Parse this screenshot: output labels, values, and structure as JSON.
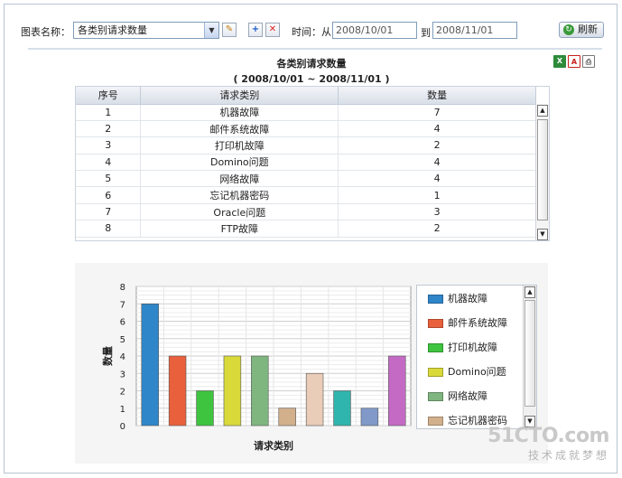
{
  "toolbar": {
    "chart_name_label": "图表名称：",
    "selected_chart": "各类别请求数量",
    "time_label": "时间：从",
    "from_date": "2008/10/01",
    "to_label": "到",
    "to_date": "2008/11/01",
    "refresh_label": "刷新"
  },
  "report": {
    "title": "各类别请求数量",
    "range": "( 2008/10/01 ~ 2008/11/01 )"
  },
  "table": {
    "headers": [
      "序号",
      "请求类别",
      "数量"
    ],
    "rows": [
      [
        "1",
        "机器故障",
        "7"
      ],
      [
        "2",
        "邮件系统故障",
        "4"
      ],
      [
        "3",
        "打印机故障",
        "2"
      ],
      [
        "4",
        "Domino问题",
        "4"
      ],
      [
        "5",
        "网络故障",
        "4"
      ],
      [
        "6",
        "忘记机器密码",
        "1"
      ],
      [
        "7",
        "Oracle问题",
        "3"
      ],
      [
        "8",
        "FTP故障",
        "2"
      ]
    ]
  },
  "chart_data": {
    "type": "bar",
    "categories": [
      "机器故障",
      "邮件系统故障",
      "打印机故障",
      "Domino问题",
      "网络故障",
      "忘记机器密码",
      "Oracle问题",
      "",
      "",
      ""
    ],
    "values": [
      7,
      4,
      2,
      4,
      4,
      1,
      3,
      2,
      1,
      4
    ],
    "colors": [
      "#2f86c8",
      "#e8603c",
      "#3ec43e",
      "#d9d93a",
      "#7fb57f",
      "#d2b08c",
      "#e9cdb8",
      "#2fb5ad",
      "#8099c9",
      "#c46ac4"
    ],
    "xlabel": "请求类别",
    "ylabel": "数量",
    "ylim": [
      0,
      8
    ],
    "yticks": [
      "0",
      "1",
      "2",
      "3",
      "4",
      "5",
      "6",
      "7",
      "8"
    ],
    "grid": true,
    "legend_position": "right",
    "legend_items": [
      "机器故障",
      "邮件系统故障",
      "打印机故障",
      "Domino问题",
      "网络故障",
      "忘记机器密码"
    ]
  },
  "watermark": {
    "brand": "51CTO.com",
    "tagline": "技术成就梦想"
  }
}
